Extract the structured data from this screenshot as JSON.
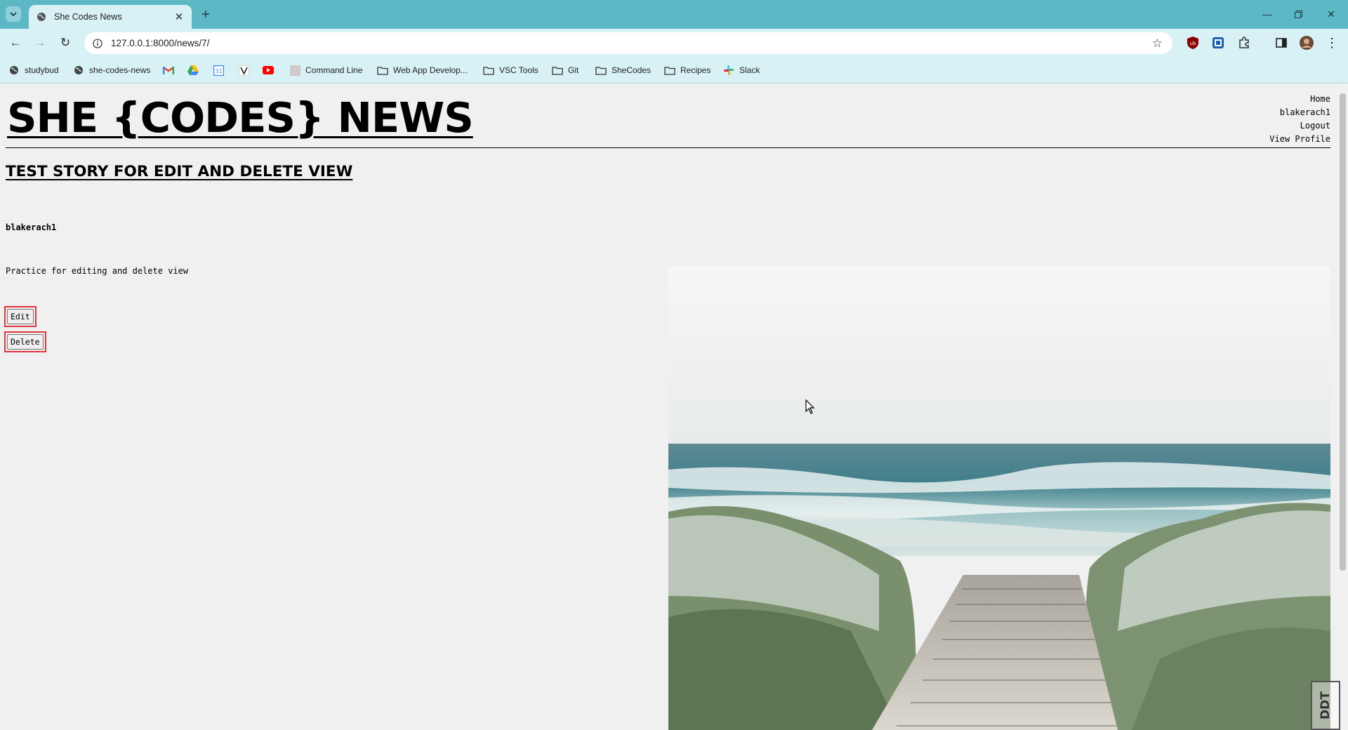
{
  "browser": {
    "tab_title": "She Codes News",
    "url": "127.0.0.1:8000/news/7/",
    "bookmarks": [
      {
        "label": "studybud",
        "icon": "globe-icon"
      },
      {
        "label": "she-codes-news",
        "icon": "globe-icon"
      },
      {
        "label": "",
        "icon": "gmail-icon"
      },
      {
        "label": "",
        "icon": "drive-icon"
      },
      {
        "label": "",
        "icon": "calendar-icon"
      },
      {
        "label": "",
        "icon": "v-icon"
      },
      {
        "label": "",
        "icon": "youtube-icon"
      },
      {
        "label": "Command Line",
        "icon": "bookmark-icon"
      },
      {
        "label": "Web App Develop...",
        "icon": "folder-icon"
      },
      {
        "label": "VSC Tools",
        "icon": "folder-icon"
      },
      {
        "label": "Git",
        "icon": "folder-icon"
      },
      {
        "label": "SheCodes",
        "icon": "folder-icon"
      },
      {
        "label": "Recipes",
        "icon": "folder-icon"
      },
      {
        "label": "Slack",
        "icon": "slack-icon"
      }
    ]
  },
  "site": {
    "title": "SHE {CODES} NEWS",
    "nav": [
      "Home",
      "blakerach1",
      "Logout",
      "View Profile"
    ]
  },
  "story": {
    "title": "TEST STORY FOR EDIT AND DELETE VIEW",
    "author": "blakerach1",
    "content": "Practice for editing and delete view",
    "edit_label": "Edit",
    "delete_label": "Delete",
    "image": "beach-boardwalk-photo"
  },
  "colors": {
    "tabstrip": "#5bb8c4",
    "toolbar": "#d8f1f4",
    "page_bg": "#f0f0f0",
    "highlight": "#e0353f"
  }
}
